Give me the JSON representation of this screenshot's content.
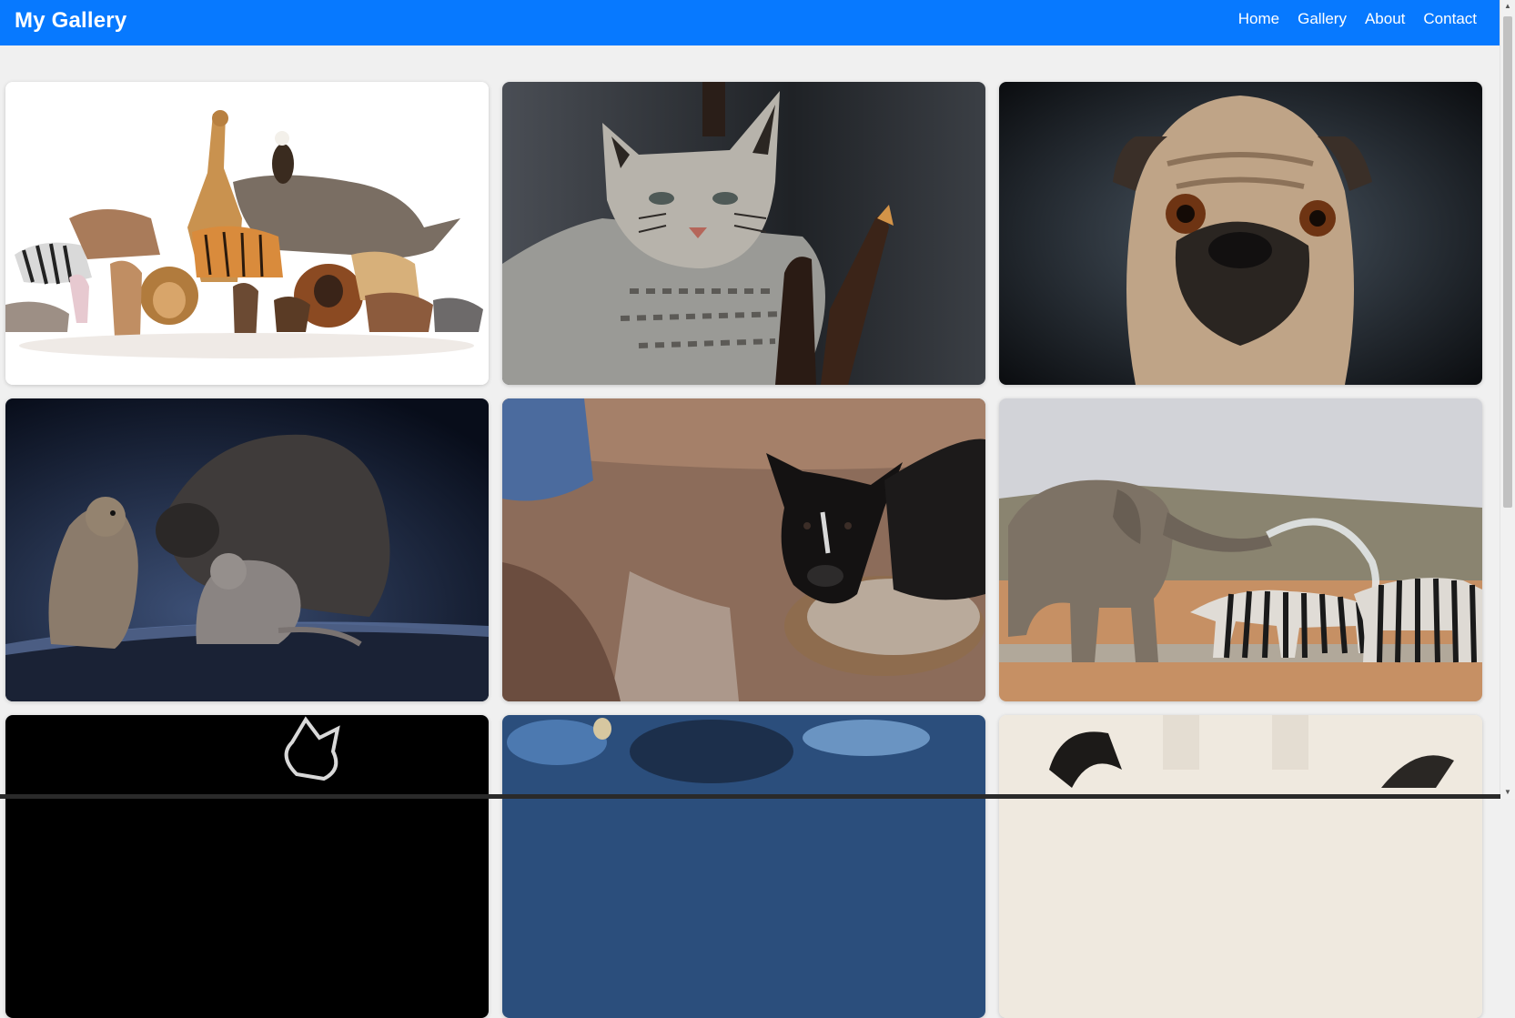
{
  "navbar": {
    "brand": "My Gallery",
    "links": [
      "Home",
      "Gallery",
      "About",
      "Contact"
    ]
  },
  "gallery": {
    "images": [
      {
        "subject": "animal-group-collage"
      },
      {
        "subject": "bobcat"
      },
      {
        "subject": "pug"
      },
      {
        "subject": "quokkas-and-wombat"
      },
      {
        "subject": "black-puppy-bowl"
      },
      {
        "subject": "elephant-spraying-zebras"
      },
      {
        "subject": "dark-skeleton-partial"
      },
      {
        "subject": "blue-partial"
      },
      {
        "subject": "light-partial"
      }
    ]
  },
  "colors": {
    "navbar_bg": "#0779ff",
    "page_bg": "#f0f0f0"
  }
}
